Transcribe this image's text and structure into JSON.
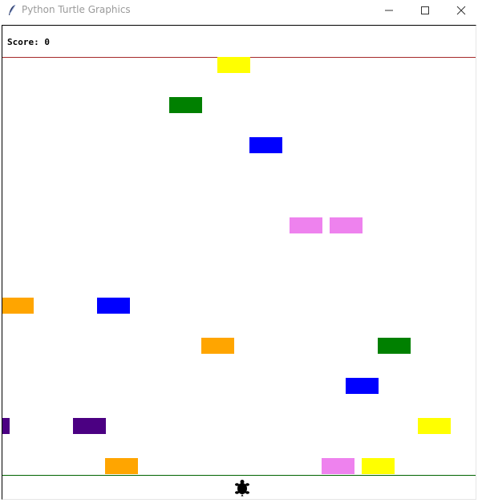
{
  "window": {
    "title": "Python Turtle Graphics",
    "icon": "feather-icon",
    "buttons": [
      "minimize-icon",
      "maximize-icon",
      "close-icon"
    ]
  },
  "game": {
    "score_label": "Score: ",
    "score_value": "0",
    "top_boundary_color": "#a52a2a",
    "bottom_boundary_color": "#006400",
    "player_icon": "turtle-icon",
    "player_color": "#000000",
    "blocks": [
      {
        "color": "yellow",
        "hex": "#ffff00"
      },
      {
        "color": "green",
        "hex": "#008000"
      },
      {
        "color": "blue",
        "hex": "#0000ff"
      },
      {
        "color": "violet",
        "hex": "#ee82ee"
      },
      {
        "color": "violet",
        "hex": "#ee82ee"
      },
      {
        "color": "orange",
        "hex": "#ffa500"
      },
      {
        "color": "blue",
        "hex": "#0000ff"
      },
      {
        "color": "orange",
        "hex": "#ffa500"
      },
      {
        "color": "green",
        "hex": "#008000"
      },
      {
        "color": "blue",
        "hex": "#0000ff"
      },
      {
        "color": "indigo",
        "hex": "#4b0082"
      },
      {
        "color": "indigo",
        "hex": "#4b0082"
      },
      {
        "color": "yellow",
        "hex": "#ffff00"
      },
      {
        "color": "orange",
        "hex": "#ffa500"
      },
      {
        "color": "violet",
        "hex": "#ee82ee"
      },
      {
        "color": "yellow",
        "hex": "#ffff00"
      }
    ]
  }
}
